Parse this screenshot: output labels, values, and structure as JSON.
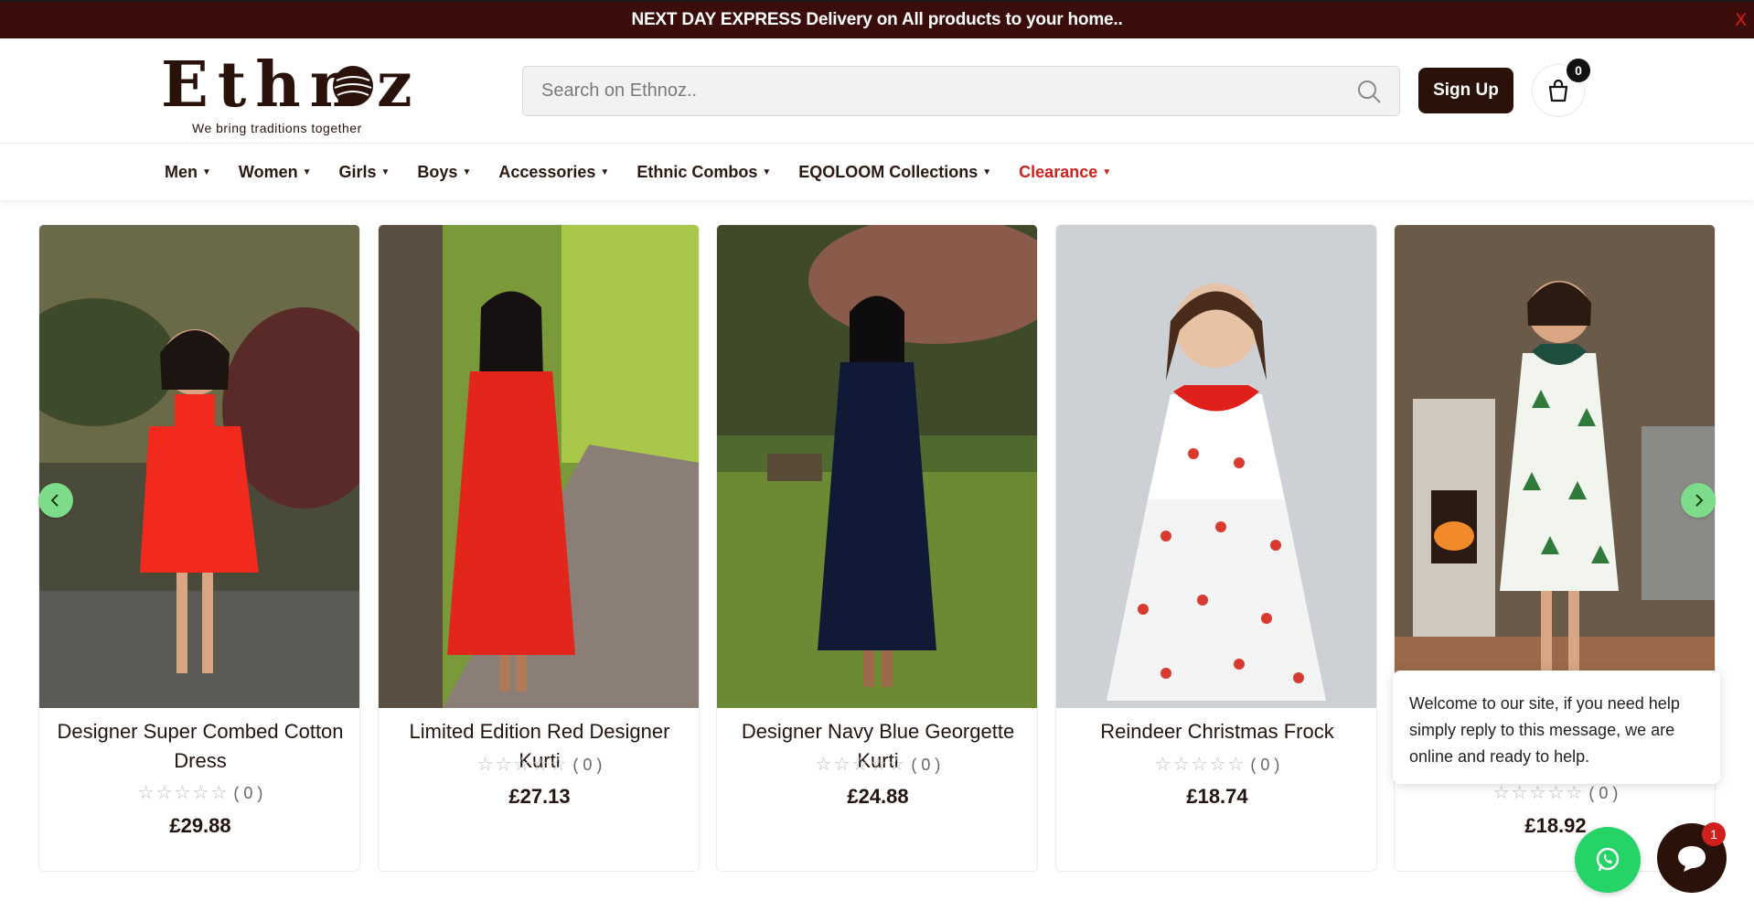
{
  "announcement": {
    "text": "NEXT DAY EXPRESS Delivery on All products to your home..",
    "close_label": "X"
  },
  "header": {
    "logo_text": "Ethnoz",
    "tagline": "We bring traditions together",
    "search_placeholder": "Search on Ethnoz..",
    "signup_label": "Sign Up",
    "cart_count": "0"
  },
  "nav": {
    "items": [
      {
        "label": "Men"
      },
      {
        "label": "Women"
      },
      {
        "label": "Girls"
      },
      {
        "label": "Boys"
      },
      {
        "label": "Accessories"
      },
      {
        "label": "Ethnic Combos"
      },
      {
        "label": "EQOLOOM Collections"
      },
      {
        "label": "Clearance"
      }
    ],
    "highlight_color": "#d0201b"
  },
  "products": [
    {
      "title": "Designer Super Combed Cotton Dress",
      "reviews": "( 0 )",
      "price": "£29.88"
    },
    {
      "title": "Limited Edition Red Designer Kurti",
      "reviews": "( 0 )",
      "price": "£27.13"
    },
    {
      "title": "Designer Navy Blue Georgette Kurti",
      "reviews": "( 0 )",
      "price": "£24.88"
    },
    {
      "title": "Reindeer Christmas Frock",
      "reviews": "( 0 )",
      "price": "£18.74"
    },
    {
      "title": "",
      "reviews": "( 0 )",
      "price": "£18.92"
    }
  ],
  "chat": {
    "message": "Welcome to our site, if you need help simply reply to this message, we are online and ready to help.",
    "unread": "1"
  },
  "colors": {
    "brand_dark": "#2a120b",
    "banner_bg": "#3a0d0a",
    "arrow_green": "#7ddc8a",
    "whatsapp_green": "#25d366"
  }
}
